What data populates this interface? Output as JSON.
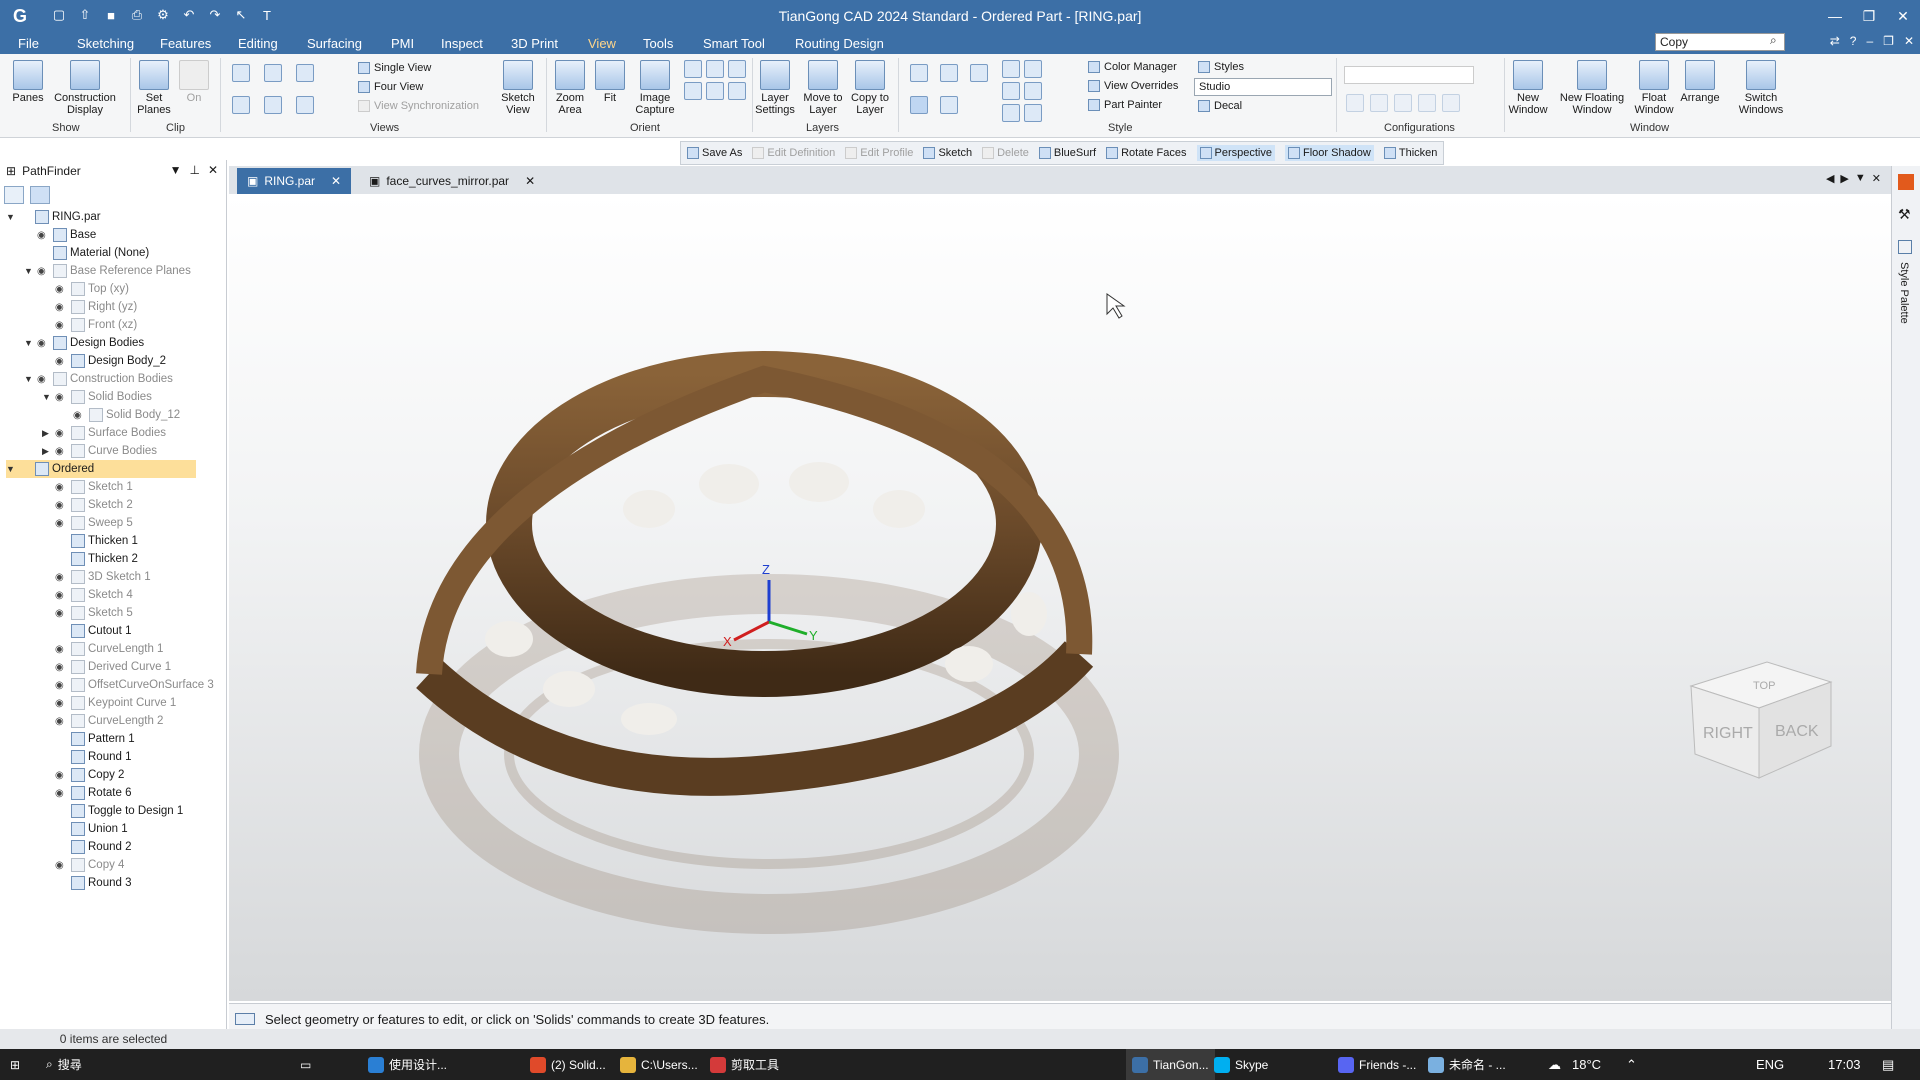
{
  "window": {
    "title": "TianGong CAD 2024 Standard - Ordered Part - [RING.par]",
    "controls": [
      "—",
      "❐",
      "✕"
    ]
  },
  "menu": {
    "items": [
      "File",
      "Sketching",
      "Features",
      "Editing",
      "Surfacing",
      "PMI",
      "Inspect",
      "3D Print",
      "View",
      "Tools",
      "Smart Tool",
      "Routing Design"
    ],
    "active": "View",
    "search_value": "Copy"
  },
  "ribbon": {
    "show": {
      "panes": "Panes",
      "construction_display": "Construction Display",
      "group": "Show"
    },
    "clip": {
      "set_planes": "Set Planes",
      "on": "On",
      "group": "Clip"
    },
    "views": {
      "single_view": "Single View",
      "four_view": "Four View",
      "view_sync": "View Synchronization",
      "sketch_view": "Sketch View",
      "group": "Views"
    },
    "orient": {
      "zoom_area": "Zoom Area",
      "fit": "Fit",
      "image_capture": "Image Capture",
      "group": "Orient"
    },
    "layers": {
      "layer_settings": "Layer Settings",
      "move_to_layer": "Move to Layer",
      "copy_to_layer": "Copy to Layer",
      "group": "Layers"
    },
    "style": {
      "color_manager": "Color Manager",
      "view_overrides": "View Overrides",
      "part_painter": "Part Painter",
      "styles": "Styles",
      "styles_value": "Studio",
      "decal": "Decal",
      "group": "Style"
    },
    "configurations": {
      "group": "Configurations"
    },
    "window": {
      "new_window": "New Window",
      "new_floating_window": "New Floating Window",
      "float_window": "Float Window",
      "arrange": "Arrange",
      "switch_windows": "Switch Windows",
      "group": "Window"
    }
  },
  "command_bar": {
    "save_as": "Save As",
    "edit_definition": "Edit Definition",
    "edit_profile": "Edit Profile",
    "sketch": "Sketch",
    "delete": "Delete",
    "bluesurf": "BlueSurf",
    "rotate_faces": "Rotate Faces",
    "perspective": "Perspective",
    "floor_shadow": "Floor Shadow",
    "thicken": "Thicken"
  },
  "pathfinder": {
    "title": "PathFinder",
    "status": "0 items are selected",
    "nodes": [
      {
        "label": "RING.par",
        "level": 0,
        "exp": "▼",
        "eye": false,
        "dim": false
      },
      {
        "label": "Base",
        "level": 1,
        "exp": "",
        "eye": true,
        "dim": false
      },
      {
        "label": "Material (None)",
        "level": 1,
        "exp": "",
        "eye": false,
        "dim": false
      },
      {
        "label": "Base Reference Planes",
        "level": 1,
        "exp": "▼",
        "eye": true,
        "dim": true
      },
      {
        "label": "Top (xy)",
        "level": 2,
        "exp": "",
        "eye": true,
        "dim": true
      },
      {
        "label": "Right (yz)",
        "level": 2,
        "exp": "",
        "eye": true,
        "dim": true
      },
      {
        "label": "Front (xz)",
        "level": 2,
        "exp": "",
        "eye": true,
        "dim": true
      },
      {
        "label": "Design Bodies",
        "level": 1,
        "exp": "▼",
        "eye": true,
        "dim": false
      },
      {
        "label": "Design Body_2",
        "level": 2,
        "exp": "",
        "eye": true,
        "dim": false
      },
      {
        "label": "Construction Bodies",
        "level": 1,
        "exp": "▼",
        "eye": true,
        "dim": true
      },
      {
        "label": "Solid Bodies",
        "level": 2,
        "exp": "▼",
        "eye": true,
        "dim": true
      },
      {
        "label": "Solid Body_12",
        "level": 3,
        "exp": "",
        "eye": true,
        "dim": true
      },
      {
        "label": "Surface Bodies",
        "level": 2,
        "exp": "▶",
        "eye": true,
        "dim": true
      },
      {
        "label": "Curve Bodies",
        "level": 2,
        "exp": "▶",
        "eye": true,
        "dim": true
      },
      {
        "label": "Ordered",
        "level": 0,
        "exp": "▼",
        "eye": false,
        "dim": false,
        "hl": true
      },
      {
        "label": "Sketch 1",
        "level": 2,
        "exp": "",
        "eye": true,
        "dim": true
      },
      {
        "label": "Sketch 2",
        "level": 2,
        "exp": "",
        "eye": true,
        "dim": true
      },
      {
        "label": "Sweep 5",
        "level": 2,
        "exp": "",
        "eye": true,
        "dim": true
      },
      {
        "label": "Thicken 1",
        "level": 2,
        "exp": "",
        "eye": false,
        "dim": false
      },
      {
        "label": "Thicken 2",
        "level": 2,
        "exp": "",
        "eye": false,
        "dim": false
      },
      {
        "label": "3D Sketch 1",
        "level": 2,
        "exp": "",
        "eye": true,
        "dim": true
      },
      {
        "label": "Sketch 4",
        "level": 2,
        "exp": "",
        "eye": true,
        "dim": true
      },
      {
        "label": "Sketch 5",
        "level": 2,
        "exp": "",
        "eye": true,
        "dim": true
      },
      {
        "label": "Cutout 1",
        "level": 2,
        "exp": "",
        "eye": false,
        "dim": false
      },
      {
        "label": "CurveLength 1",
        "level": 2,
        "exp": "",
        "eye": true,
        "dim": true
      },
      {
        "label": "Derived Curve 1",
        "level": 2,
        "exp": "",
        "eye": true,
        "dim": true
      },
      {
        "label": "OffsetCurveOnSurface 3",
        "level": 2,
        "exp": "",
        "eye": true,
        "dim": true
      },
      {
        "label": "Keypoint Curve 1",
        "level": 2,
        "exp": "",
        "eye": true,
        "dim": true
      },
      {
        "label": "CurveLength 2",
        "level": 2,
        "exp": "",
        "eye": true,
        "dim": true
      },
      {
        "label": "Pattern 1",
        "level": 2,
        "exp": "",
        "eye": false,
        "dim": false
      },
      {
        "label": "Round 1",
        "level": 2,
        "exp": "",
        "eye": false,
        "dim": false
      },
      {
        "label": "Copy 2",
        "level": 2,
        "exp": "",
        "eye": true,
        "dim": false
      },
      {
        "label": "Rotate 6",
        "level": 2,
        "exp": "",
        "eye": true,
        "dim": false
      },
      {
        "label": "Toggle to Design 1",
        "level": 2,
        "exp": "",
        "eye": false,
        "dim": false
      },
      {
        "label": "Union 1",
        "level": 2,
        "exp": "",
        "eye": false,
        "dim": false
      },
      {
        "label": "Round 2",
        "level": 2,
        "exp": "",
        "eye": false,
        "dim": false
      },
      {
        "label": "Copy 4",
        "level": 2,
        "exp": "",
        "eye": true,
        "dim": true
      },
      {
        "label": "Round 3",
        "level": 2,
        "exp": "",
        "eye": false,
        "dim": false
      }
    ]
  },
  "tabs": [
    {
      "label": "RING.par",
      "active": true
    },
    {
      "label": "face_curves_mirror.par",
      "active": false
    }
  ],
  "viewport": {
    "axis_x": "X",
    "axis_y": "Y",
    "axis_z": "Z",
    "cube_right": "RIGHT",
    "cube_back": "BACK",
    "cube_top": "TOP",
    "ring_color": "#6b4a2a"
  },
  "prompt": "Select geometry or features to edit, or click on 'Solids' commands to create 3D features.",
  "side_palette": "Style Palette",
  "taskbar": {
    "search": "搜尋",
    "items": [
      "使用设计...",
      "(2) Solid...",
      "C:\\Users...",
      "剪取工具",
      "TianGon...",
      "Skype",
      "Friends -...",
      "未命名 - ..."
    ],
    "temp": "18°C",
    "lang": "ENG",
    "time": "17:03"
  }
}
